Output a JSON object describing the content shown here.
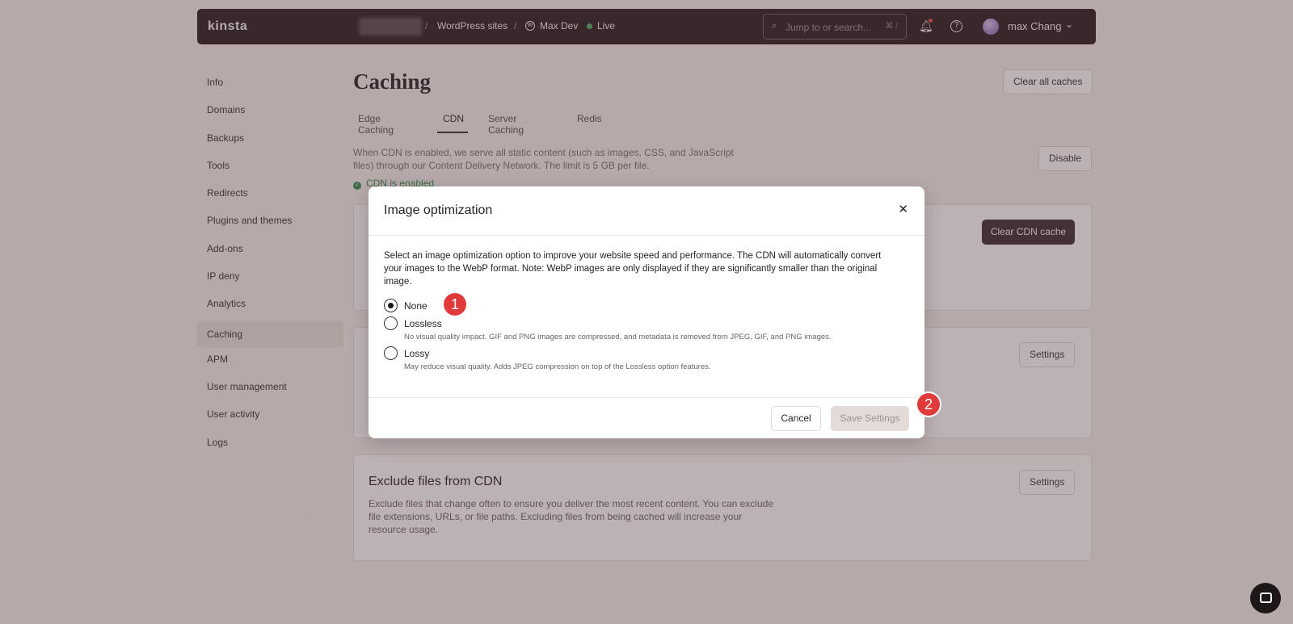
{
  "topbar": {
    "logo": "kinsta",
    "breadcrumb": [
      {
        "label": "WordPress sites"
      },
      {
        "label": "Max Dev"
      },
      {
        "label": "Live"
      }
    ],
    "separator": "/",
    "search_placeholder": "Jump to or search...",
    "search_shortcut": "⌘ /",
    "user_name": "max Chang"
  },
  "sidebar": {
    "items": [
      {
        "label": "Info"
      },
      {
        "label": "Domains"
      },
      {
        "label": "Backups"
      },
      {
        "label": "Tools"
      },
      {
        "label": "Redirects"
      },
      {
        "label": "Plugins and themes"
      },
      {
        "label": "Add-ons"
      },
      {
        "label": "IP deny"
      },
      {
        "label": "Analytics"
      },
      {
        "label": "Caching",
        "active": true
      },
      {
        "label": "APM"
      },
      {
        "label": "User management"
      },
      {
        "label": "User activity"
      },
      {
        "label": "Logs"
      }
    ]
  },
  "page": {
    "title": "Caching",
    "clear_all_label": "Clear all caches",
    "tabs": [
      {
        "label": "Edge Caching"
      },
      {
        "label": "CDN",
        "active": true
      },
      {
        "label": "Server Caching"
      },
      {
        "label": "Redis"
      }
    ],
    "cdn_description": "When CDN is enabled, we serve all static content (such as images, CSS, and JavaScript files) through our Content Delivery Network. The limit is 5 GB per file.",
    "cdn_status": "CDN is enabled",
    "disable_label": "Disable",
    "clear_cdn_label": "Clear CDN cache",
    "settings_label": "Settings",
    "exclude_title": "Exclude files from CDN",
    "exclude_description": "Exclude files that change often to ensure you deliver the most recent content. You can exclude file extensions, URLs, or file paths. Excluding files from being cached will increase your resource usage.",
    "exclude_settings_label": "Settings"
  },
  "modal": {
    "title": "Image optimization",
    "intro": "Select an image optimization option to improve your website speed and performance. The CDN will automatically convert your images to the WebP format. Note: WebP images are only displayed if they are significantly smaller than the original image.",
    "options": [
      {
        "label": "None",
        "description": "",
        "selected": true
      },
      {
        "label": "Lossless",
        "description": "No visual quality impact. GIF and PNG images are compressed, and metadata is removed from JPEG, GIF, and PNG images.",
        "selected": false
      },
      {
        "label": "Lossy",
        "description": "May reduce visual quality. Adds JPEG compression on top of the Lossless option features.",
        "selected": false
      }
    ],
    "cancel_label": "Cancel",
    "save_label": "Save Settings"
  },
  "markers": [
    "1",
    "2"
  ],
  "colors": {
    "topbar_bg": "#2d2224",
    "accent_dark": "#3d3033",
    "status_green": "#3a8a55",
    "marker_red": "#e03a3a"
  }
}
